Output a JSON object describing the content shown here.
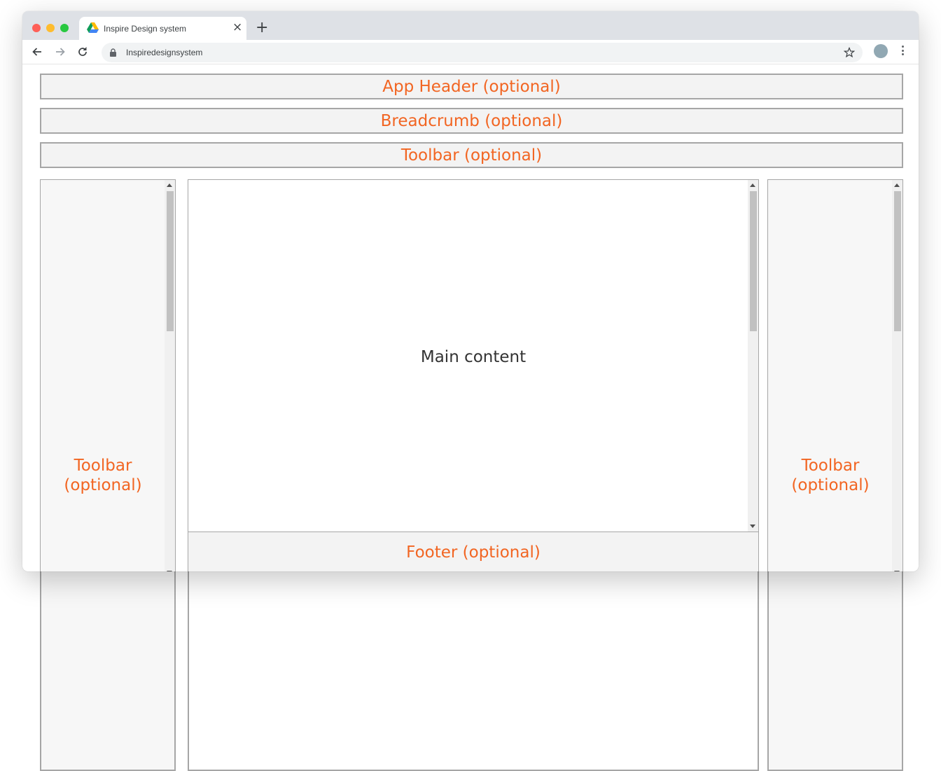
{
  "browser": {
    "tab_title": "Inspire Design system",
    "tab_close": "×",
    "new_tab": "+",
    "url": "Inspiredesignsystem",
    "icons": [
      "back-arrow-icon",
      "forward-arrow-icon",
      "reload-icon",
      "lock-icon",
      "star-icon",
      "profile-avatar",
      "more-menu-icon",
      "drive-favicon"
    ],
    "colors": {
      "tabstrip": "#dee1e6",
      "close_dot": "#fe5f57",
      "minimize_dot": "#febc2e",
      "maximize_dot": "#28c840",
      "avatar": "#91a8b3"
    }
  },
  "layout": {
    "app_header": "App Header (optional)",
    "breadcrumb": "Breadcrumb (optional)",
    "toolbar_top": "Toolbar (optional)",
    "toolbar_left": "Toolbar\n(optional)",
    "toolbar_right": "Toolbar\n(optional)",
    "main_content": "Main content",
    "footer": "Footer (optional)",
    "colors": {
      "label_accent": "#f26522",
      "border": "#a6a6a6",
      "panel_fill": "#f3f3f3"
    }
  }
}
